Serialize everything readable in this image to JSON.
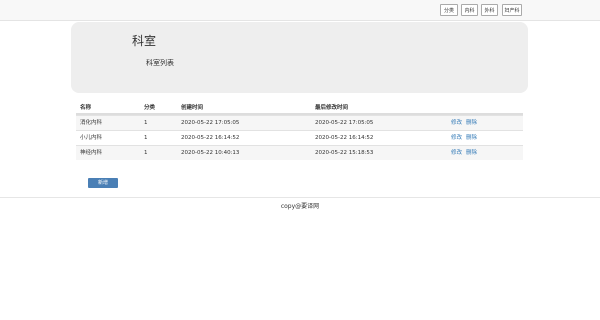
{
  "nav": {
    "items": [
      {
        "label": "分类"
      },
      {
        "label": "内科"
      },
      {
        "label": "外科"
      },
      {
        "label": "妇产科"
      }
    ]
  },
  "header": {
    "title": "科室",
    "subtitle": "科室列表"
  },
  "table": {
    "columns": [
      "名称",
      "分类",
      "创建时间",
      "最后修改时间"
    ],
    "rows": [
      {
        "name": "消化内科",
        "category": "1",
        "created": "2020-05-22 17:05:05",
        "modified": "2020-05-22 17:05:05",
        "edit": "修改",
        "delete": "删除"
      },
      {
        "name": "小儿内科",
        "category": "1",
        "created": "2020-05-22 16:14:52",
        "modified": "2020-05-22 16:14:52",
        "edit": "修改",
        "delete": "删除"
      },
      {
        "name": "神经内科",
        "category": "1",
        "created": "2020-05-22 10:40:13",
        "modified": "2020-05-22 15:18:53",
        "edit": "修改",
        "delete": "删除"
      }
    ]
  },
  "actions": {
    "add_label": "新增"
  },
  "footer": {
    "text": "copy@要译网"
  }
}
